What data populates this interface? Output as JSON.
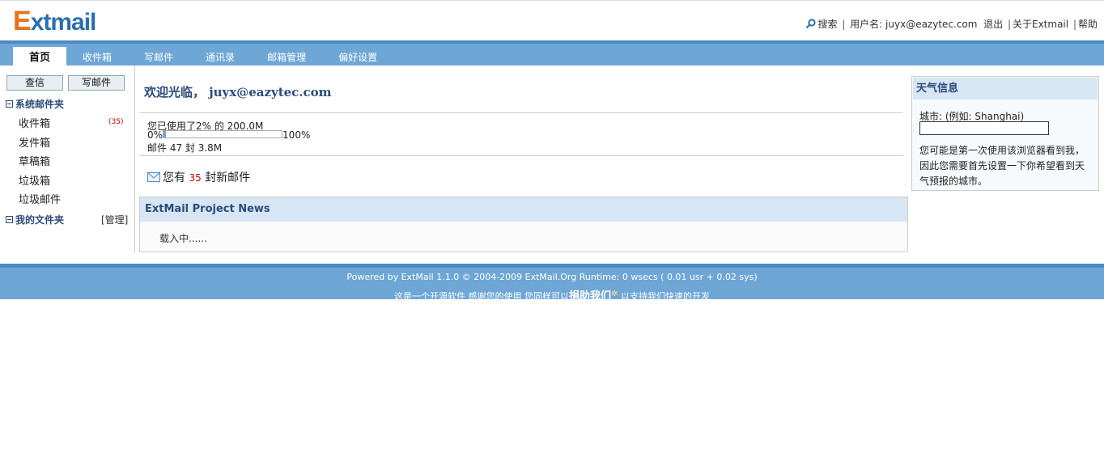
{
  "logo": {
    "first": "E",
    "rest": "xtmail"
  },
  "topbar": {
    "search": "搜索",
    "user_label": "用户名:",
    "user_email": "juyx@eazytec.com",
    "logout": "退出",
    "about": "关于Extmail",
    "help": "帮助"
  },
  "nav": {
    "tabs": [
      "首页",
      "收件箱",
      "写邮件",
      "通讯录",
      "邮箱管理",
      "偏好设置"
    ],
    "active": "首页"
  },
  "sidebar": {
    "check_button": "查信",
    "compose_button": "写邮件",
    "system_folders_label": "系统邮件夹",
    "folders": [
      {
        "label": "收件箱",
        "count": "(35)"
      },
      {
        "label": "发件箱"
      },
      {
        "label": "草稿箱"
      },
      {
        "label": "垃圾箱"
      },
      {
        "label": "垃圾邮件"
      }
    ],
    "my_folders_label": "我的文件夹",
    "manage": "[管理]"
  },
  "main": {
    "welcome": "欢迎光临， juyx@eazytec.com",
    "quota_text": "您已使用了2% 的 200.0M",
    "bar_min": "0%",
    "bar_max": "100%",
    "usage_fraction": 0.02,
    "mail_count_text": "邮件 47 封 3.8M",
    "new_mail_prefix": "您有",
    "new_mail_count": "35",
    "new_mail_suffix": "封新邮件",
    "news_title": "ExtMail Project News",
    "news_loading": "载入中......"
  },
  "weather": {
    "title": "天气信息",
    "city_label": "城市:  (例如: Shanghai)",
    "city_value": "",
    "message": "您可能是第一次使用该浏览器看到我，因此您需要首先设置一下你希望看到天气预报的城市。"
  },
  "footer": {
    "powered": "Powered by ExtMail 1.1.0 © 2004-2009 ExtMail.Org Runtime: 0 wsecs ( 0.01 usr + 0.02 sys)",
    "line2_prefix": "这是一个开源软件 感谢您的使用 您同样可以",
    "donate": "捐助我们",
    "line2_suffix": "以支持我们快速的开发"
  },
  "colors": {
    "nav_bg": "#6ea6d6",
    "accent": "#2d4a7a",
    "logo_orange": "#e8711c",
    "logo_blue": "#2a6fb0",
    "alert": "#cc0000"
  }
}
